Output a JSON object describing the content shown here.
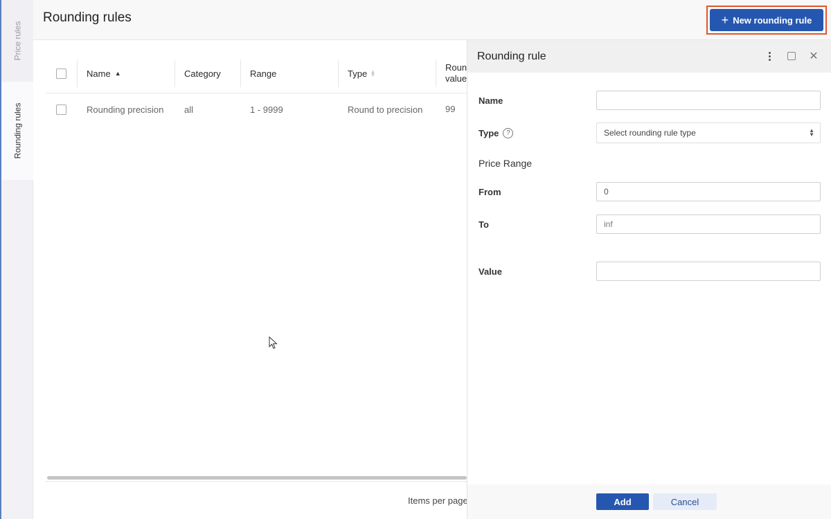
{
  "rail": {
    "tabs": [
      {
        "label": "Price rules",
        "active": false
      },
      {
        "label": "Rounding rules",
        "active": true
      }
    ]
  },
  "header": {
    "title": "Rounding rules",
    "new_button_label": "New rounding rule",
    "new_button_icon": "plus-icon"
  },
  "table": {
    "columns": [
      {
        "label": "Name",
        "sort": "ascending"
      },
      {
        "label": "Category",
        "sort": null
      },
      {
        "label": "Range",
        "sort": null
      },
      {
        "label": "Type",
        "sort": "none"
      },
      {
        "label": "Rounding value",
        "label_visible": "Roun value",
        "sort": null
      }
    ],
    "rows": [
      {
        "name": "Rounding precision",
        "category": "all",
        "range": "1 - 9999",
        "type": "Round to precision",
        "value": "99"
      }
    ],
    "footer": {
      "items_per_page_label": "Items per page"
    }
  },
  "panel": {
    "title": "Rounding rule",
    "actions": [
      "more-options-icon",
      "maximize-icon",
      "close-icon"
    ],
    "fields": {
      "name": {
        "label": "Name",
        "value": "",
        "placeholder": ""
      },
      "type": {
        "label": "Type",
        "placeholder": "Select rounding rule type",
        "help": "?"
      },
      "price_range_title": "Price Range",
      "from": {
        "label": "From",
        "value": "0"
      },
      "to": {
        "label": "To",
        "value": "",
        "placeholder": "inf"
      },
      "value": {
        "label": "Value",
        "value": "",
        "placeholder": ""
      }
    },
    "footer": {
      "add_label": "Add",
      "cancel_label": "Cancel"
    }
  },
  "colors": {
    "primary": "#2657b0",
    "highlight_outline": "#e0552a",
    "rail_accent": "#5b7fc0"
  }
}
